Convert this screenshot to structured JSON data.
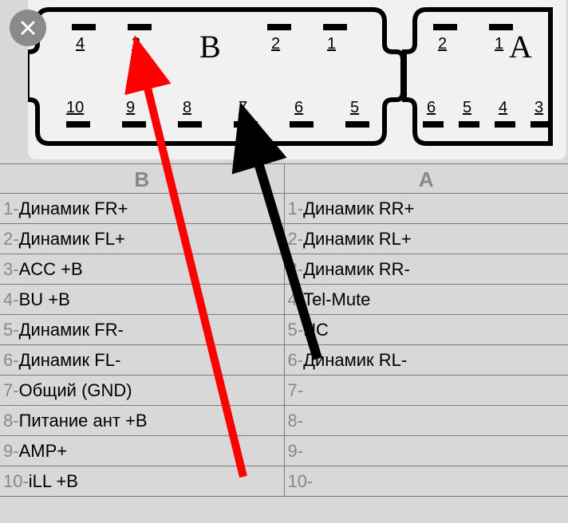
{
  "close_icon": "close",
  "connectors": {
    "B": {
      "label": "B",
      "top_pins": [
        "4",
        "3",
        "2",
        "1"
      ],
      "bottom_pins": [
        "10",
        "9",
        "8",
        "7",
        "6",
        "5"
      ]
    },
    "A": {
      "label": "A",
      "top_pins": [
        "2",
        "1"
      ],
      "bottom_pins": [
        "6",
        "5",
        "4",
        "3"
      ]
    }
  },
  "table": {
    "headers": {
      "B": "B",
      "A": "A"
    },
    "rows": [
      {
        "bn": "1-",
        "bl": "Динамик FR+",
        "an": "1-",
        "al": "Динамик RR+"
      },
      {
        "bn": "2-",
        "bl": "Динамик FL+",
        "an": "2-",
        "al": "Динамик RL+"
      },
      {
        "bn": "3-",
        "bl": "ACC +B",
        "an": "3-",
        "al": "Динамик RR-"
      },
      {
        "bn": "4-",
        "bl": "BU +B",
        "an": "4-",
        "al": "Tel-Mute"
      },
      {
        "bn": "5-",
        "bl": "Динамик FR-",
        "an": "5-",
        "al": "NC"
      },
      {
        "bn": "6-",
        "bl": "Динамик FL-",
        "an": "6-",
        "al": "Динамик RL-"
      },
      {
        "bn": "7-",
        "bl": "Общий (GND)",
        "an": "7-",
        "al": ""
      },
      {
        "bn": "8-",
        "bl": "Питание ант +B",
        "an": "8-",
        "al": ""
      },
      {
        "bn": "9-",
        "bl": "AMP+",
        "an": "9-",
        "al": ""
      },
      {
        "bn": "10-",
        "bl": "iLL +B",
        "an": "10-",
        "al": ""
      }
    ]
  },
  "arrows": {
    "red": {
      "from_pin": "B3",
      "color": "#ff0000"
    },
    "black": {
      "from_pin": "B7",
      "color": "#000000"
    }
  }
}
